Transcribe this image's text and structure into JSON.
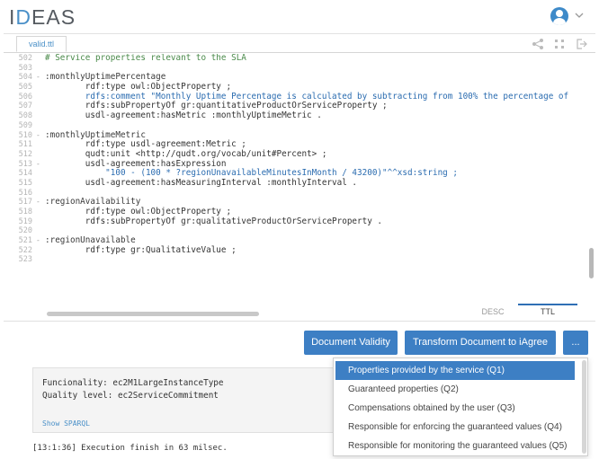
{
  "app": {
    "logo_main": "I",
    "logo_accent": "D",
    "logo_rest": "EAS"
  },
  "editor": {
    "file_tab": "valid.ttl",
    "lines": [
      {
        "n": "502",
        "fold": "",
        "text": "# Service properties relevant to the SLA",
        "kind": "comment"
      },
      {
        "n": "503",
        "fold": "",
        "text": "",
        "kind": "plain"
      },
      {
        "n": "504",
        "fold": "-",
        "text": ":monthlyUptimePercentage",
        "kind": "subject"
      },
      {
        "n": "505",
        "fold": "",
        "text": "        rdf:type owl:ObjectProperty ;",
        "kind": "plain"
      },
      {
        "n": "506",
        "fold": "",
        "text": "        rdfs:comment \"Monthly Uptime Percentage is calculated by subtracting from 100% the percentage of",
        "kind": "string"
      },
      {
        "n": "507",
        "fold": "",
        "text": "        rdfs:subPropertyOf gr:quantitativeProductOrServiceProperty ;",
        "kind": "plain"
      },
      {
        "n": "508",
        "fold": "",
        "text": "        usdl-agreement:hasMetric :monthlyUptimeMetric .",
        "kind": "plain"
      },
      {
        "n": "509",
        "fold": "",
        "text": "",
        "kind": "plain"
      },
      {
        "n": "510",
        "fold": "-",
        "text": ":monthlyUptimeMetric",
        "kind": "subject"
      },
      {
        "n": "511",
        "fold": "",
        "text": "        rdf:type usdl-agreement:Metric ;",
        "kind": "plain"
      },
      {
        "n": "512",
        "fold": "",
        "text": "        qudt:unit <http://qudt.org/vocab/unit#Percent> ;",
        "kind": "plain"
      },
      {
        "n": "513",
        "fold": "-",
        "text": "        usdl-agreement:hasExpression",
        "kind": "plain"
      },
      {
        "n": "514",
        "fold": "",
        "text": "            \"100 - (100 * ?regionUnavailableMinutesInMonth / 43200)\"^^xsd:string ;",
        "kind": "string"
      },
      {
        "n": "515",
        "fold": "",
        "text": "        usdl-agreement:hasMeasuringInterval :monthlyInterval .",
        "kind": "plain"
      },
      {
        "n": "516",
        "fold": "",
        "text": "",
        "kind": "plain"
      },
      {
        "n": "517",
        "fold": "-",
        "text": ":regionAvailability",
        "kind": "subject"
      },
      {
        "n": "518",
        "fold": "",
        "text": "        rdf:type owl:ObjectProperty ;",
        "kind": "plain"
      },
      {
        "n": "519",
        "fold": "",
        "text": "        rdfs:subPropertyOf gr:qualitativeProductOrServiceProperty .",
        "kind": "plain"
      },
      {
        "n": "520",
        "fold": "",
        "text": "",
        "kind": "plain"
      },
      {
        "n": "521",
        "fold": "-",
        "text": ":regionUnavailable",
        "kind": "subject"
      },
      {
        "n": "522",
        "fold": "",
        "text": "        rdf:type gr:QualitativeValue ;",
        "kind": "plain"
      },
      {
        "n": "523",
        "fold": "",
        "text": "",
        "kind": "plain"
      }
    ]
  },
  "view_tabs": {
    "desc": "DESC",
    "ttl": "TTL"
  },
  "actions": {
    "validity": "Document Validity",
    "transform": "Transform Document to iAgree",
    "more": "..."
  },
  "result": {
    "functionality": "Funcionality: ec2M1LargeInstanceType",
    "quality": "Quality level: ec2ServiceCommitment",
    "show_sparql": "Show SPARQL",
    "log": "[13:1:36] Execution finish in 63 milsec."
  },
  "menu": {
    "items": [
      "Properties provided by the service (Q1)",
      "Guaranteed properties (Q2)",
      "Compensations obtained by the user (Q3)",
      "Responsible for enforcing the guaranteed values (Q4)",
      "Responsible for monitoring the guaranteed values (Q5)"
    ],
    "selected_index": 0
  },
  "colors": {
    "accent": "#3d7fc4",
    "logo_accent": "#4a90c8",
    "comment": "#4a8a4a",
    "string": "#2b6cb0"
  },
  "icons": {
    "user": "user-avatar-icon",
    "chevron": "chevron-down-icon",
    "share": "share-icon",
    "fullscreen": "fullscreen-icon",
    "exit": "exit-icon"
  }
}
